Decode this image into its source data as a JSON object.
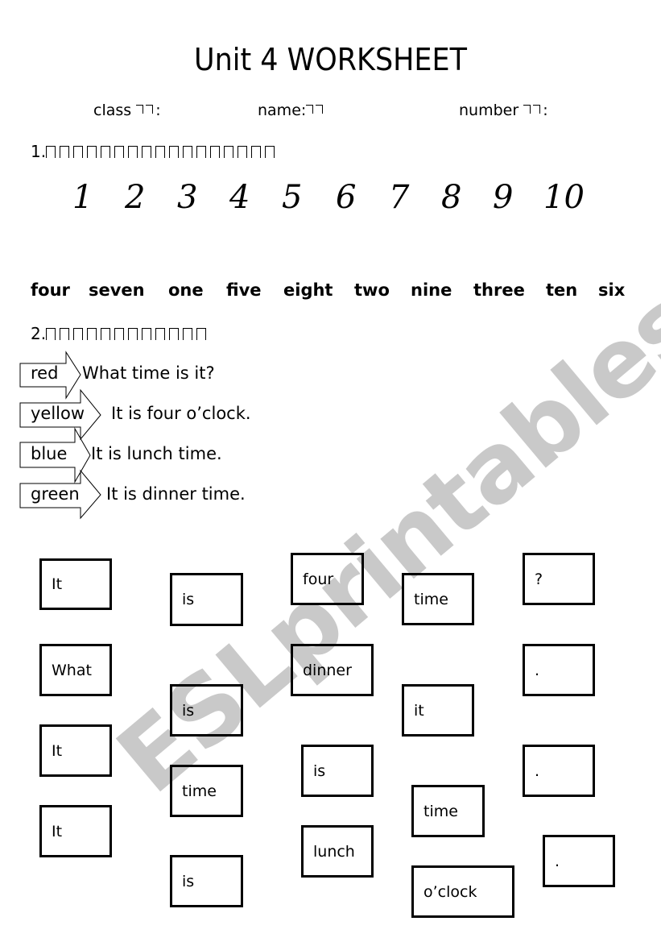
{
  "title": "Unit 4 WORKSHEET",
  "info": {
    "class_label": "class",
    "class_suffix": ":",
    "name_label": "name:",
    "number_label": "number",
    "number_suffix": ":"
  },
  "section1": {
    "heading_prefix": "1.",
    "placeholder_glyph_count": 17,
    "numbers": [
      "1",
      "2",
      "3",
      "4",
      "5",
      "6",
      "7",
      "8",
      "9",
      "10"
    ],
    "words": [
      "four",
      "seven",
      "one",
      "five",
      "eight",
      "two",
      "nine",
      "three",
      "ten",
      "six"
    ]
  },
  "section2": {
    "heading_prefix": "2.",
    "placeholder_glyph_count": 12,
    "arrows": [
      {
        "label": "red",
        "sentence": "What time is it?"
      },
      {
        "label": "yellow",
        "sentence": "It is four o’clock."
      },
      {
        "label": "blue",
        "sentence": "It is lunch time."
      },
      {
        "label": "green",
        "sentence": "It is dinner time."
      }
    ]
  },
  "word_cards": [
    {
      "text": "It"
    },
    {
      "text": "is"
    },
    {
      "text": "four"
    },
    {
      "text": "time"
    },
    {
      "text": "?"
    },
    {
      "text": "What"
    },
    {
      "text": "dinner"
    },
    {
      "text": "."
    },
    {
      "text": "is"
    },
    {
      "text": "it"
    },
    {
      "text": "It"
    },
    {
      "text": "is"
    },
    {
      "text": "."
    },
    {
      "text": "time"
    },
    {
      "text": "time"
    },
    {
      "text": "It"
    },
    {
      "text": "lunch"
    },
    {
      "text": "."
    },
    {
      "text": "is"
    },
    {
      "text": "o’clock"
    }
  ],
  "watermark": "ESLprintables.com"
}
